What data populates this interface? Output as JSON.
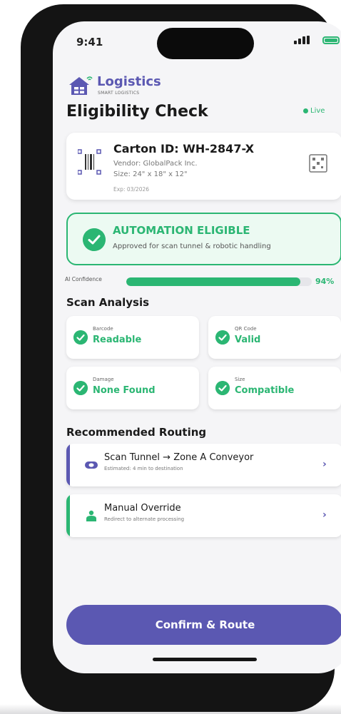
{
  "status_bar": {
    "time": "9:41"
  },
  "brand": {
    "name": "Logistics",
    "subtitle": "SMART LOGISTICS"
  },
  "page": {
    "title": "Eligibility Check",
    "live_label": "Live"
  },
  "carton": {
    "id_label": "Carton ID: WH-2847-X",
    "vendor": "Vendor: GlobalPack Inc.",
    "size": "Size: 24\" x 18\" x 12\"",
    "exp": "Exp: 03/2026"
  },
  "eligibility": {
    "title": "AUTOMATION ELIGIBLE",
    "subtitle": "Approved for scan tunnel & robotic handling"
  },
  "confidence": {
    "label": "AI Confidence",
    "value_pct": 94,
    "display": "94%"
  },
  "scan_analysis": {
    "title": "Scan Analysis",
    "items": [
      {
        "caption": "Barcode",
        "value": "Readable"
      },
      {
        "caption": "QR Code",
        "value": "Valid"
      },
      {
        "caption": "Damage",
        "value": "None Found"
      },
      {
        "caption": "Size",
        "value": "Compatible"
      }
    ]
  },
  "routing": {
    "title": "Recommended Routing",
    "items": [
      {
        "title": "Scan Tunnel → Zone A Conveyor",
        "subtitle": "Estimated: 4 min to destination",
        "accent": "#5b58b2",
        "icon": "tunnel-icon"
      },
      {
        "title": "Manual Override",
        "subtitle": "Redirect to alternate processing",
        "accent": "#2bb673",
        "icon": "person-icon"
      }
    ]
  },
  "actions": {
    "confirm_label": "Confirm & Route"
  },
  "colors": {
    "primary": "#5b58b2",
    "success": "#2bb673",
    "background": "#f5f5f7"
  }
}
